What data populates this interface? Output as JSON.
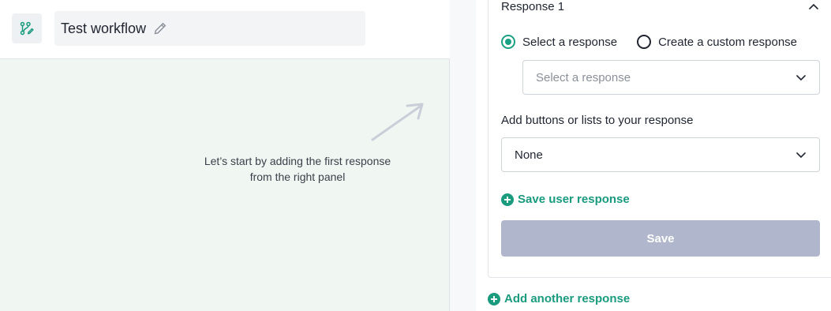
{
  "header": {
    "workflow_title": "Test workflow",
    "workflow_icon": "workflow-icon",
    "edit_icon": "pencil-icon"
  },
  "canvas": {
    "hint_line1": "Let’s start by adding the first response",
    "hint_line2": "from the right panel",
    "arrow_icon": "arrow-up-right-icon"
  },
  "panel": {
    "response_title": "Response 1",
    "collapse_icon": "chevron-up-icon",
    "radio_options": [
      {
        "label": "Select a response",
        "checked": true
      },
      {
        "label": "Create a custom response",
        "checked": false
      }
    ],
    "select_response_placeholder": "Select a response",
    "buttons_label": "Add buttons or lists to your response",
    "buttons_value": "None",
    "save_user_response": "Save user response",
    "save_button": "Save",
    "add_another_response": "Add another response"
  },
  "colors": {
    "accent": "#1a9a7e",
    "canvas_bg": "#f0f6f2",
    "save_disabled": "#b0b6cb"
  }
}
